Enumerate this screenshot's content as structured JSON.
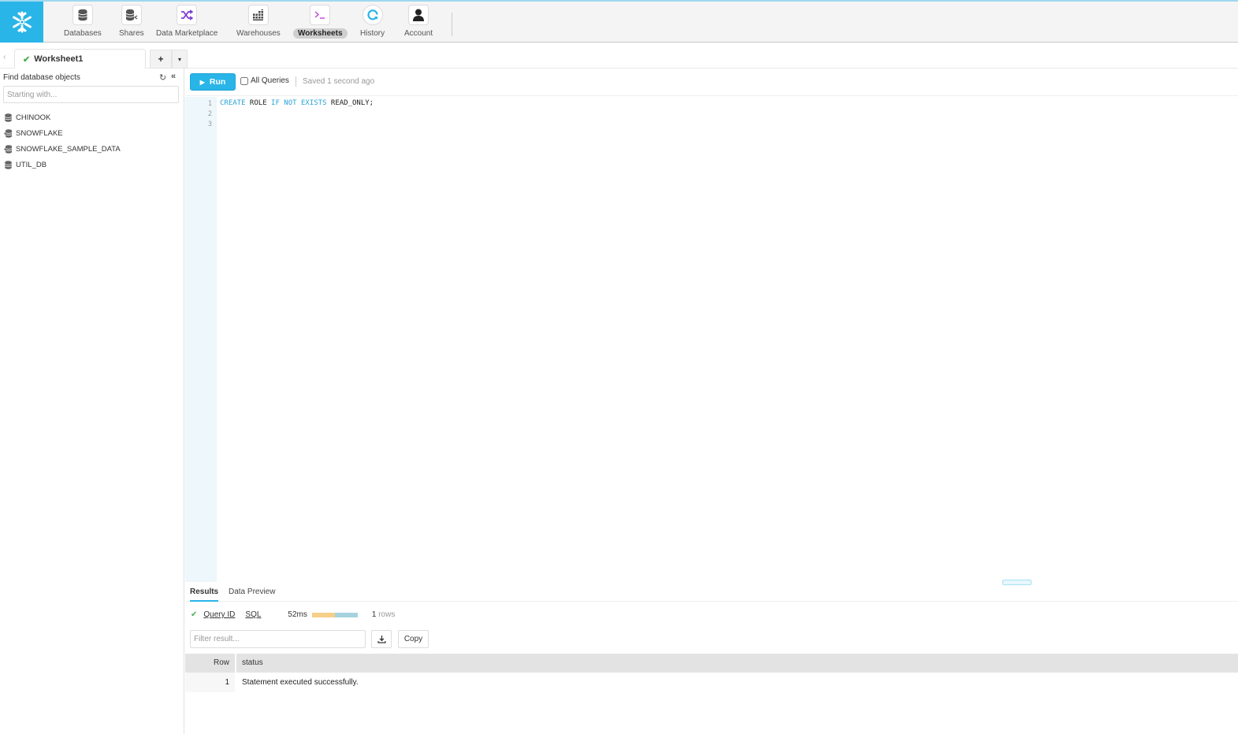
{
  "nav": {
    "items": [
      {
        "label": "Databases",
        "icon": "database-icon"
      },
      {
        "label": "Shares",
        "icon": "shares-icon"
      },
      {
        "label": "Data Marketplace",
        "icon": "marketplace-shuffle-icon"
      },
      {
        "label": "Warehouses",
        "icon": "warehouse-grid-icon"
      },
      {
        "label": "Worksheets",
        "icon": "terminal-icon",
        "active": true
      },
      {
        "label": "History",
        "icon": "history-icon"
      },
      {
        "label": "Account",
        "icon": "account-person-icon"
      }
    ],
    "brand_color": "#29b5e8"
  },
  "tabs": {
    "worksheet_name": "Worksheet1",
    "add_label": "+",
    "menu_label": "▾",
    "back_label": "‹"
  },
  "sidebar": {
    "title": "Find database objects",
    "search_placeholder": "Starting with...",
    "databases": [
      {
        "name": "CHINOOK",
        "shared": false
      },
      {
        "name": "SNOWFLAKE",
        "shared": true
      },
      {
        "name": "SNOWFLAKE_SAMPLE_DATA",
        "shared": true
      },
      {
        "name": "UTIL_DB",
        "shared": false
      }
    ]
  },
  "toolbar": {
    "run_label": "Run",
    "all_queries_label": "All Queries",
    "all_queries_checked": false,
    "saved_status": "Saved 1 second ago"
  },
  "editor": {
    "line_numbers": [
      "1",
      "2",
      "3"
    ],
    "line1": {
      "t1": "CREATE",
      "t2": " ROLE ",
      "t3": "IF",
      "t4": " ",
      "t5": "NOT",
      "t6": " ",
      "t7": "EXISTS",
      "t8": " READ_ONLY;"
    }
  },
  "results": {
    "tabs": [
      "Results",
      "Data Preview"
    ],
    "active_tab": "Results",
    "query_id_label": "Query ID",
    "sql_label": "SQL",
    "duration": "52ms",
    "duration_breakdown": {
      "compile_fraction": 0.5,
      "execute_fraction": 0.5
    },
    "row_count": "1",
    "rows_label": "rows",
    "filter_placeholder": "Filter result...",
    "copy_label": "Copy",
    "columns": [
      "Row",
      "status"
    ],
    "rows": [
      {
        "row": "1",
        "status": "Statement executed successfully."
      }
    ]
  }
}
